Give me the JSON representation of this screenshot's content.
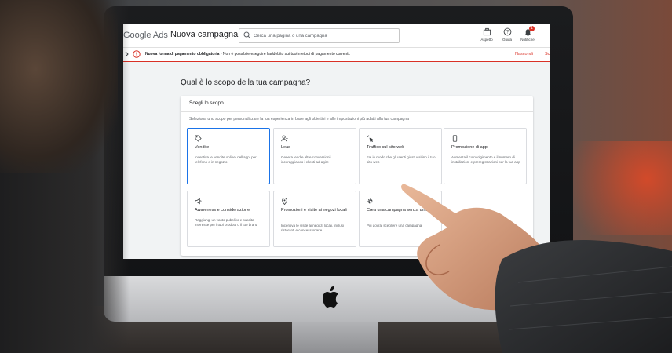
{
  "header": {
    "logo_text": "Google Ads",
    "page_title": "Nuova campagna",
    "search_placeholder": "Cerca una pagina o una campagna",
    "help_label": "Aspetto",
    "guide_label": "Guida",
    "notifications_label": "Notifiche",
    "notifications_count": "1"
  },
  "alert": {
    "title": "Nuova forma di pagamento obbligatoria",
    "message": " - Non è possibile eseguire l'addebito sui tuoi metodi di pagamento correnti.",
    "hide_label": "Nascondi",
    "more_label": "Sc"
  },
  "main": {
    "question": "Qual è lo scopo della tua campagna?",
    "card_title": "Scegli lo scopo",
    "card_description": "Seleziona uno scopo per personalizzare la tua esperienza in base agli obiettivi e alle impostazioni più adatti alla tua campagna",
    "options": [
      {
        "icon": "tag-icon",
        "title": "Vendite",
        "description": "Incentiva le vendite online, nell'app, per telefono o in negozio",
        "selected": true
      },
      {
        "icon": "leads-icon",
        "title": "Lead",
        "description": "Genera lead e altre conversioni incoraggiando i clienti ad agire",
        "selected": false
      },
      {
        "icon": "cursor-click-icon",
        "title": "Traffico sul sito web",
        "description": "Fai in modo che gli utenti giusti visitino il tuo sito web",
        "selected": false
      },
      {
        "icon": "app-promo-icon",
        "title": "Promozione di app",
        "description": "Aumenta il coinvolgimento e il numero di installazioni e preregistrazioni per la tua app",
        "selected": false
      },
      {
        "icon": "megaphone-icon",
        "title": "Awareness e considerazione",
        "description": "Raggiungi un vasto pubblico e suscita interesse per i tuoi prodotti o il tuo brand",
        "selected": false
      },
      {
        "icon": "location-pin-icon",
        "title": "Promozioni e visite ai negozi locali",
        "description": "Incentiva le visite ai negozi locali, inclusi ristoranti e concessionarie",
        "selected": false
      },
      {
        "icon": "gear-icon",
        "title": "Crea una campagna senza un ausilio",
        "description": "Più dovrai scegliere una campagna",
        "selected": false
      }
    ]
  },
  "colors": {
    "accent": "#1a73e8",
    "alert": "#d93025",
    "background": "#f1f3f4"
  }
}
